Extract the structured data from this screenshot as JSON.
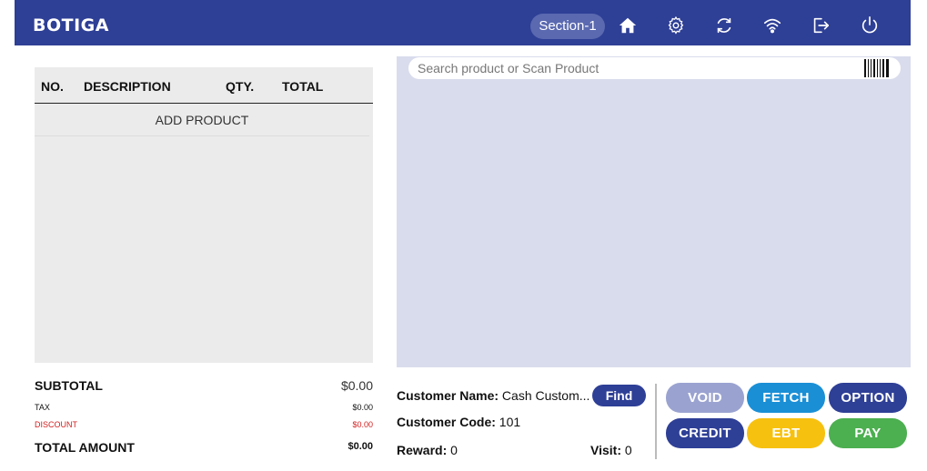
{
  "header": {
    "logo": "BOTIGA",
    "section": "Section-1",
    "icons": [
      "home-icon",
      "settings-icon",
      "refresh-icon",
      "wifi-icon",
      "logout-icon",
      "power-icon"
    ]
  },
  "cart": {
    "columns": [
      "NO.",
      "DESCRIPTION",
      "QTY.",
      "TOTAL"
    ],
    "add_product": "ADD PRODUCT"
  },
  "totals": {
    "subtotal_label": "SUBTOTAL",
    "subtotal_value": "$0.00",
    "tax_label": "TAX",
    "tax_value": "$0.00",
    "discount_label": "DISCOUNT",
    "discount_value": "$0.00",
    "total_label": "TOTAL AMOUNT",
    "total_value": "$0.00"
  },
  "search": {
    "placeholder": "Search product or Scan Product"
  },
  "customer": {
    "name_label": "Customer Name:",
    "name_value": "Cash Custom...",
    "find_label": "Find",
    "code_label": "Customer Code:",
    "code_value": "101",
    "reward_label": "Reward:",
    "reward_value": "0",
    "visit_label": "Visit:",
    "visit_value": "0"
  },
  "actions": {
    "void": "VOID",
    "fetch": "FETCH",
    "option": "OPTION",
    "credit": "CREDIT",
    "ebt": "EBT",
    "pay": "PAY"
  },
  "colors": {
    "brand": "#2e3f96",
    "void": "#9aa3d0",
    "fetch": "#1a8fd6",
    "option": "#2e3f96",
    "credit": "#2e3f96",
    "ebt": "#f7c10f",
    "pay": "#4caf50",
    "discount": "#d42020"
  }
}
